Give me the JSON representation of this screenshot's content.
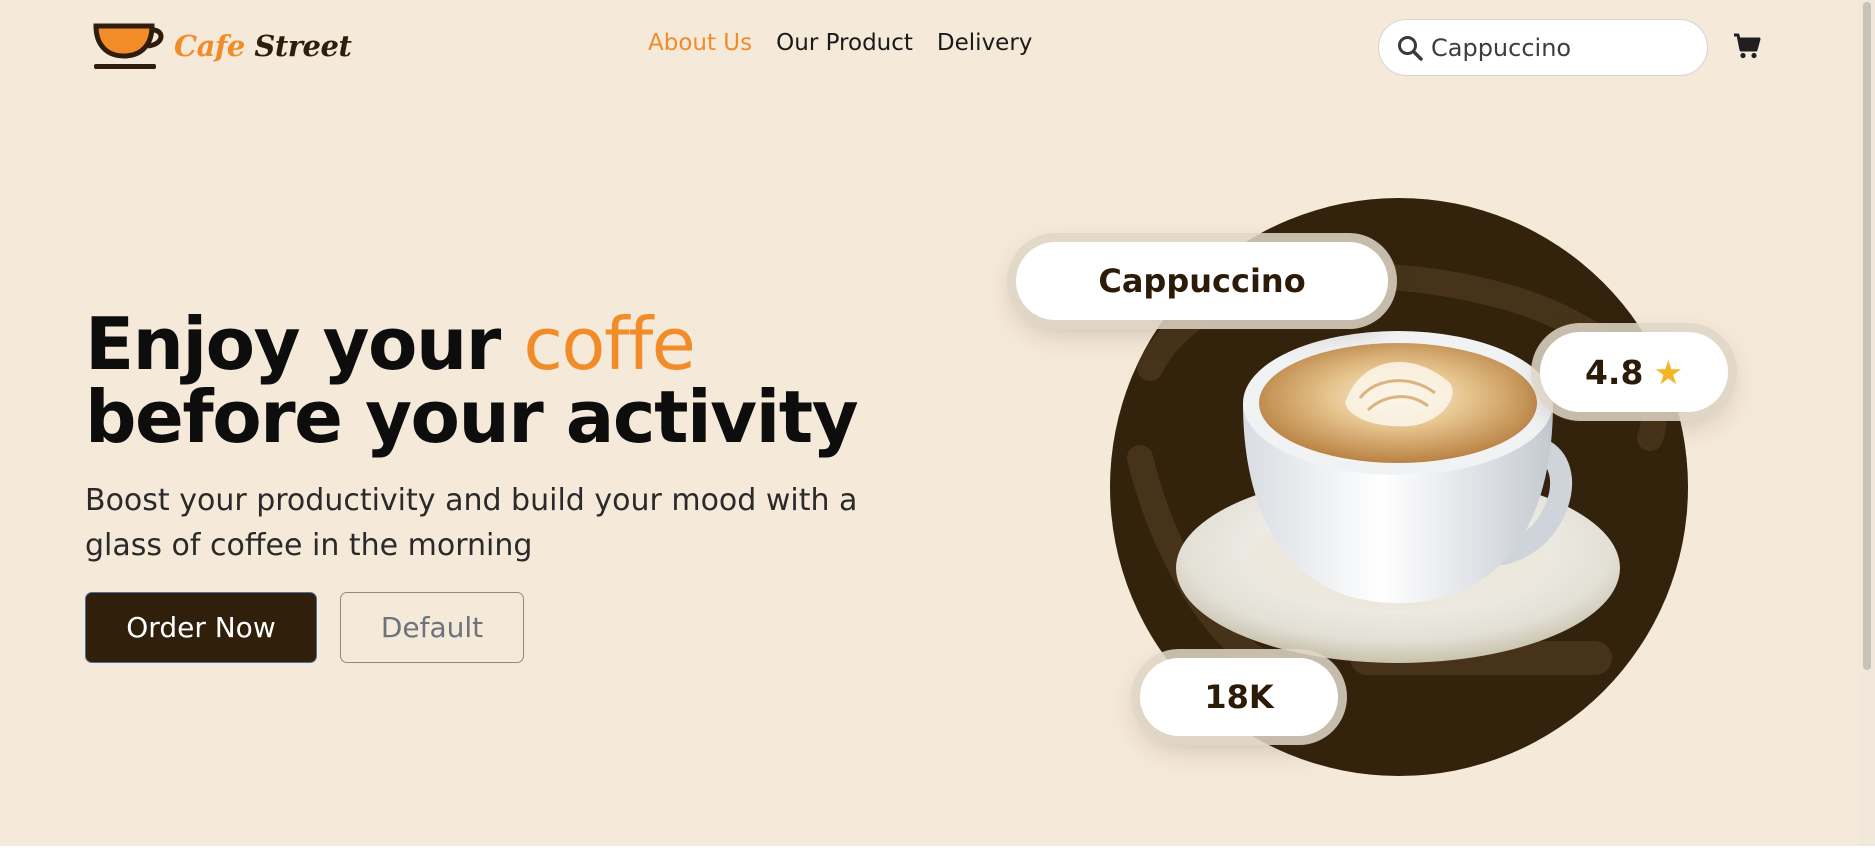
{
  "brand": {
    "logo_word_1": "Cafe",
    "logo_word_2": "Street",
    "accent_color": "#f28c28",
    "dark_color": "#2f1f0b"
  },
  "nav": {
    "items": [
      {
        "label": "About Us",
        "active": true
      },
      {
        "label": "Our Product",
        "active": false
      },
      {
        "label": "Delivery",
        "active": false
      }
    ]
  },
  "search": {
    "value": "Cappuccino",
    "icon": "search-icon"
  },
  "cart": {
    "icon": "cart-icon"
  },
  "hero": {
    "headline_part1": "Enjoy your ",
    "headline_accent": "coffe",
    "headline_part2": "before your activity",
    "subtitle": "Boost your productivity and build your mood with a glass of coffee in the morning",
    "primary_button": "Order Now",
    "secondary_button": "Default"
  },
  "product_card": {
    "name": "Cappuccino",
    "rating": "4.8",
    "rating_icon": "star-icon",
    "count": "18K"
  }
}
